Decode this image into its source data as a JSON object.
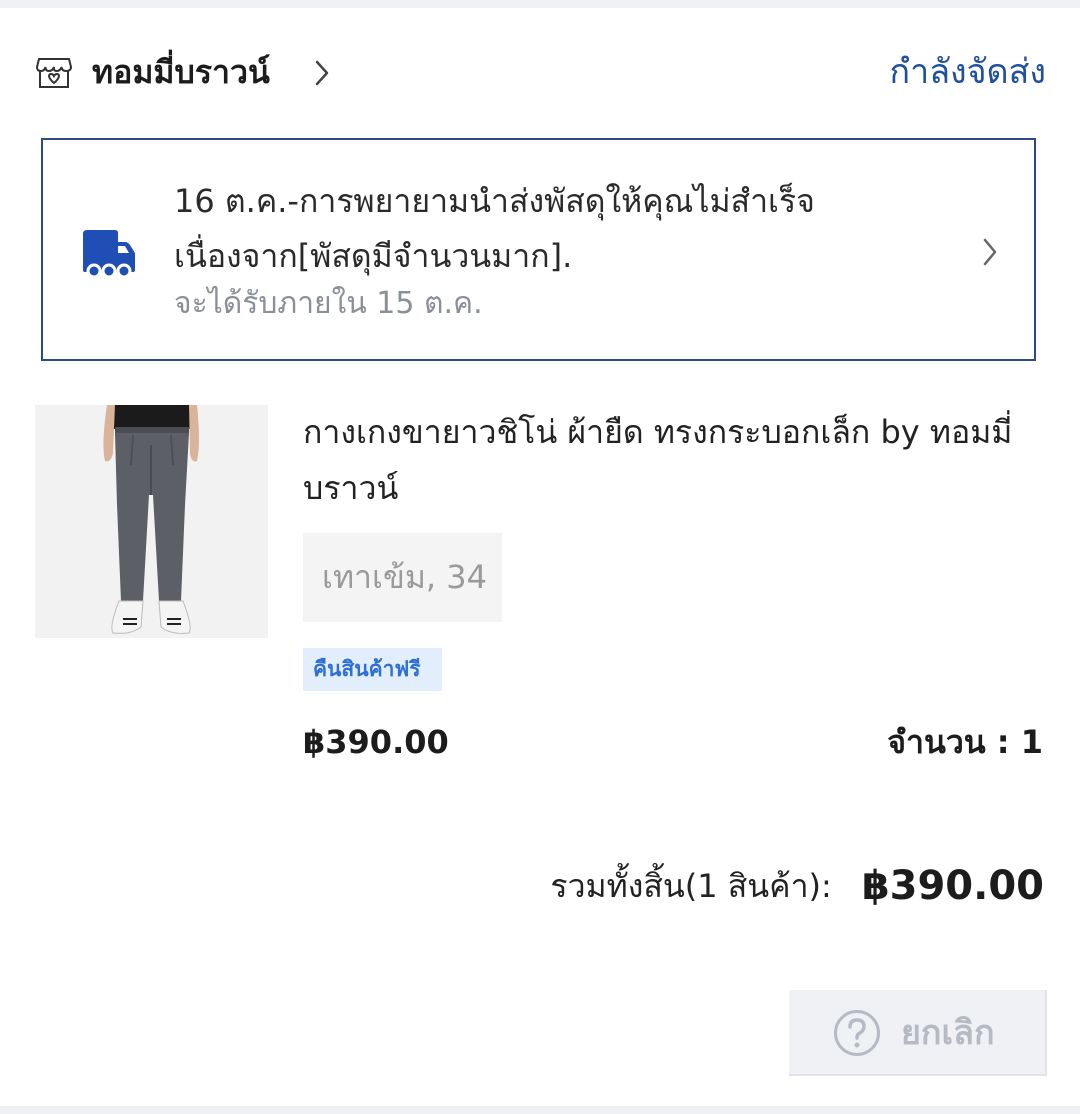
{
  "header": {
    "shop_icon": "store-icon",
    "shop_name": "ทอมมี่บราวน์",
    "shop_chevron": "chevron-right-icon",
    "status": "กำลังจัดส่ง",
    "status_color": "#1f4fa0"
  },
  "delivery": {
    "icon": "truck-icon",
    "icon_color": "#1f4fb5",
    "message": "16 ต.ค.-การพยายามนำส่งพัสดุให้คุณไม่สำเร็จเนื่องจาก[พัสดุมีจำนวนมาก].",
    "estimate": "จะได้รับภายใน 15 ต.ค.",
    "chevron": "chevron-right-icon"
  },
  "product": {
    "image": "product-pants-image",
    "title": "กางเกงขายาวชิโน่ ผ้ายืด ทรงกระบอกเล็ก by ทอมมี่บราวน์",
    "variant": "เทาเข้ม, 34",
    "badge": "คืนสินค้าฟรี",
    "badge_color": "#2d6fd6",
    "price": "฿390.00",
    "quantity": "จำนวน : 1"
  },
  "summary": {
    "total_label": "รวมทั้งสิ้น(1 สินค้า):",
    "total_value": "฿390.00"
  },
  "actions": {
    "cancel_icon": "help-icon",
    "cancel_label": "ยกเลิก"
  }
}
